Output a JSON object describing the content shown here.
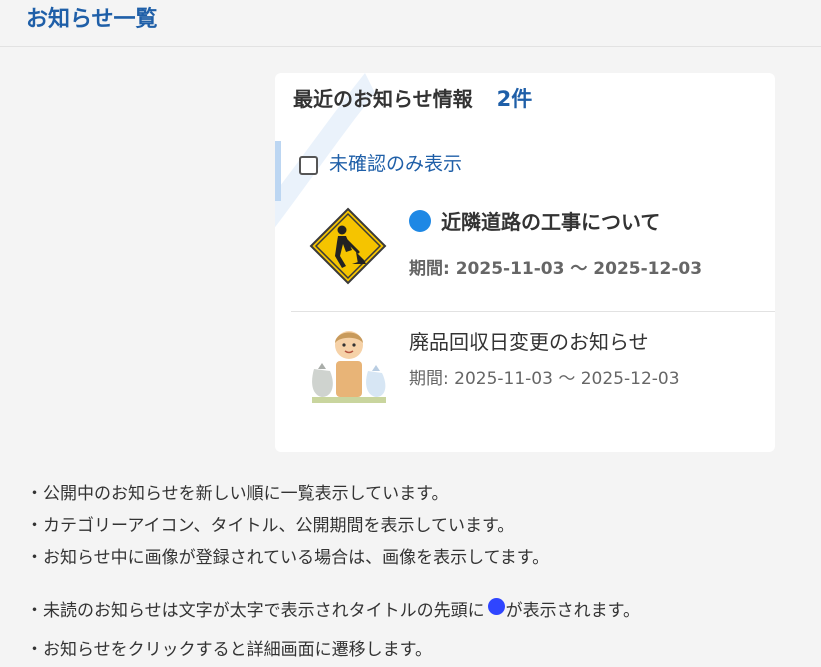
{
  "page": {
    "title": "お知らせ一覧"
  },
  "card": {
    "heading": "最近のお知らせ情報",
    "count": "2件",
    "filter_label": "未確認のみ表示",
    "filter_checked": false
  },
  "notices": [
    {
      "title": "近隣道路の工事について",
      "period": "期間: 2025-11-03 〜 2025-12-03",
      "unread": true,
      "icon": "construction-sign-icon"
    },
    {
      "title": "廃品回収日変更のお知らせ",
      "period": "期間: 2025-11-03 〜 2025-12-03",
      "unread": false,
      "icon": "garbage-collection-illustration"
    }
  ],
  "descriptions": {
    "d1": "・公開中のお知らせを新しい順に一覧表示しています。",
    "d2": "・カテゴリーアイコン、タイトル、公開期間を表示しています。",
    "d3": "・お知らせ中に画像が登録されている場合は、画像を表示してます。",
    "d4_before": "・未読のお知らせは文字が太字で表示されタイトルの先頭に",
    "d4_after": "が表示されます。",
    "d5": "・お知らせをクリックすると詳細画面に遷移します。"
  },
  "colors": {
    "accent": "#1f5fa8",
    "unread_dot": "#1e88e5",
    "legend_dot": "#2f45ff",
    "background": "#f4f4f4"
  }
}
